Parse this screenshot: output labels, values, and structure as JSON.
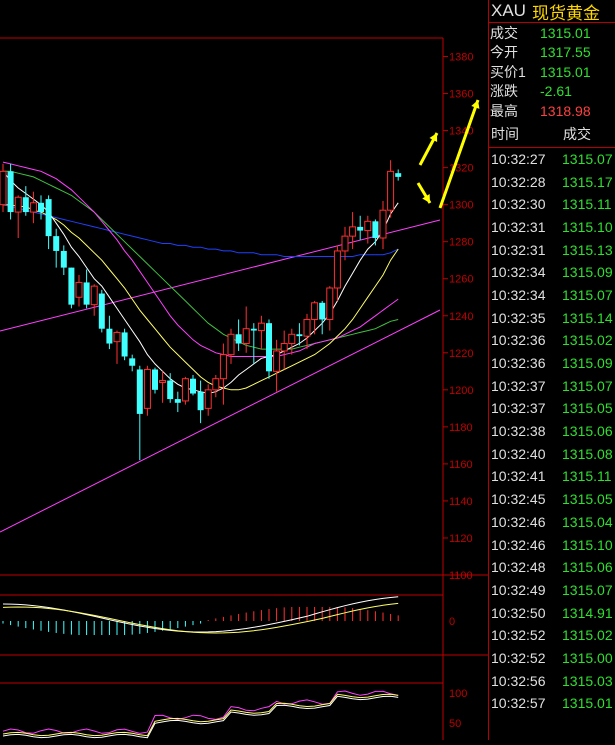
{
  "quote": {
    "code": "XAU",
    "name": "现货黄金",
    "rows": [
      {
        "label": "成交",
        "value": "1315.01",
        "color": "#2fe02f"
      },
      {
        "label": "今开",
        "value": "1317.55",
        "color": "#2fe02f"
      },
      {
        "label": "买价1",
        "value": "1315.01",
        "color": "#2fe02f"
      },
      {
        "label": "涨跌",
        "value": "-2.61",
        "color": "#2fe02f"
      },
      {
        "label": "最高",
        "value": "1318.98",
        "color": "#ff4040"
      }
    ]
  },
  "ticks": {
    "header_time": "时间",
    "header_price": "成交",
    "rows": [
      {
        "time": "10:32:27",
        "price": "1315.07"
      },
      {
        "time": "10:32:28",
        "price": "1315.17"
      },
      {
        "time": "10:32:30",
        "price": "1315.11"
      },
      {
        "time": "10:32:31",
        "price": "1315.10"
      },
      {
        "time": "10:32:31",
        "price": "1315.13"
      },
      {
        "time": "10:32:34",
        "price": "1315.09"
      },
      {
        "time": "10:32:34",
        "price": "1315.07"
      },
      {
        "time": "10:32:35",
        "price": "1315.14"
      },
      {
        "time": "10:32:36",
        "price": "1315.02"
      },
      {
        "time": "10:32:36",
        "price": "1315.09"
      },
      {
        "time": "10:32:37",
        "price": "1315.07"
      },
      {
        "time": "10:32:37",
        "price": "1315.05"
      },
      {
        "time": "10:32:38",
        "price": "1315.06"
      },
      {
        "time": "10:32:40",
        "price": "1315.08"
      },
      {
        "time": "10:32:41",
        "price": "1315.11"
      },
      {
        "time": "10:32:45",
        "price": "1315.05"
      },
      {
        "time": "10:32:46",
        "price": "1315.04"
      },
      {
        "time": "10:32:46",
        "price": "1315.10"
      },
      {
        "time": "10:32:48",
        "price": "1315.06"
      },
      {
        "time": "10:32:49",
        "price": "1315.07"
      },
      {
        "time": "10:32:50",
        "price": "1314.91"
      },
      {
        "time": "10:32:52",
        "price": "1315.02"
      },
      {
        "time": "10:32:52",
        "price": "1315.00"
      },
      {
        "time": "10:32:56",
        "price": "1315.03"
      },
      {
        "time": "10:32:57",
        "price": "1315.01"
      }
    ]
  },
  "chart_data": {
    "type": "candlestick",
    "price_axis": {
      "ticks": [
        1100,
        1120,
        1140,
        1160,
        1180,
        1200,
        1220,
        1240,
        1260,
        1280,
        1300,
        1320,
        1340,
        1360,
        1380
      ],
      "range": [
        1100,
        1390
      ]
    },
    "macd_axis": {
      "ticks": [
        "0"
      ]
    },
    "osc_axis": {
      "ticks": [
        "100",
        "50"
      ]
    },
    "colors": {
      "up": "#ff3030",
      "down": "#40ffff",
      "axis": "#c00000",
      "ma_white": "#ffffff",
      "ma_yellow": "#ffff66",
      "ma_purple": "#ff40ff",
      "ma_green": "#40c040",
      "ma_blue": "#2040ff",
      "trendline": "#ff40ff",
      "annotation_arrows": "#ffff00"
    },
    "candles": [
      {
        "o": 1300,
        "h": 1322,
        "l": 1296,
        "c": 1318
      },
      {
        "o": 1318,
        "h": 1322,
        "l": 1292,
        "c": 1296
      },
      {
        "o": 1296,
        "h": 1305,
        "l": 1282,
        "c": 1304
      },
      {
        "o": 1304,
        "h": 1310,
        "l": 1294,
        "c": 1296
      },
      {
        "o": 1296,
        "h": 1307,
        "l": 1290,
        "c": 1301
      },
      {
        "o": 1301,
        "h": 1305,
        "l": 1292,
        "c": 1296
      },
      {
        "o": 1303,
        "h": 1305,
        "l": 1276,
        "c": 1283
      },
      {
        "o": 1283,
        "h": 1287,
        "l": 1266,
        "c": 1275
      },
      {
        "o": 1275,
        "h": 1278,
        "l": 1262,
        "c": 1266
      },
      {
        "o": 1266,
        "h": 1266,
        "l": 1244,
        "c": 1246
      },
      {
        "o": 1250,
        "h": 1262,
        "l": 1245,
        "c": 1258
      },
      {
        "o": 1258,
        "h": 1265,
        "l": 1244,
        "c": 1246
      },
      {
        "o": 1246,
        "h": 1257,
        "l": 1240,
        "c": 1256
      },
      {
        "o": 1252,
        "h": 1254,
        "l": 1231,
        "c": 1233
      },
      {
        "o": 1233,
        "h": 1240,
        "l": 1222,
        "c": 1225
      },
      {
        "o": 1226,
        "h": 1232,
        "l": 1214,
        "c": 1231
      },
      {
        "o": 1231,
        "h": 1233,
        "l": 1216,
        "c": 1218
      },
      {
        "o": 1217,
        "h": 1219,
        "l": 1210,
        "c": 1213
      },
      {
        "o": 1211,
        "h": 1213,
        "l": 1162,
        "c": 1187
      },
      {
        "o": 1190,
        "h": 1213,
        "l": 1186,
        "c": 1211
      },
      {
        "o": 1211,
        "h": 1212,
        "l": 1198,
        "c": 1200
      },
      {
        "o": 1204,
        "h": 1210,
        "l": 1193,
        "c": 1205
      },
      {
        "o": 1205,
        "h": 1209,
        "l": 1193,
        "c": 1195
      },
      {
        "o": 1195,
        "h": 1199,
        "l": 1188,
        "c": 1193
      },
      {
        "o": 1194,
        "h": 1207,
        "l": 1192,
        "c": 1206
      },
      {
        "o": 1206,
        "h": 1208,
        "l": 1197,
        "c": 1198
      },
      {
        "o": 1199,
        "h": 1205,
        "l": 1182,
        "c": 1189
      },
      {
        "o": 1190,
        "h": 1203,
        "l": 1186,
        "c": 1200
      },
      {
        "o": 1200,
        "h": 1208,
        "l": 1196,
        "c": 1206
      },
      {
        "o": 1206,
        "h": 1225,
        "l": 1192,
        "c": 1219
      },
      {
        "o": 1219,
        "h": 1233,
        "l": 1214,
        "c": 1230
      },
      {
        "o": 1230,
        "h": 1238,
        "l": 1221,
        "c": 1225
      },
      {
        "o": 1225,
        "h": 1245,
        "l": 1220,
        "c": 1233
      },
      {
        "o": 1233,
        "h": 1236,
        "l": 1214,
        "c": 1232
      },
      {
        "o": 1232,
        "h": 1240,
        "l": 1222,
        "c": 1236
      },
      {
        "o": 1236,
        "h": 1238,
        "l": 1206,
        "c": 1210
      },
      {
        "o": 1210,
        "h": 1227,
        "l": 1199,
        "c": 1221
      },
      {
        "o": 1221,
        "h": 1232,
        "l": 1211,
        "c": 1225
      },
      {
        "o": 1225,
        "h": 1233,
        "l": 1219,
        "c": 1230
      },
      {
        "o": 1230,
        "h": 1236,
        "l": 1224,
        "c": 1229
      },
      {
        "o": 1229,
        "h": 1241,
        "l": 1222,
        "c": 1238
      },
      {
        "o": 1238,
        "h": 1248,
        "l": 1230,
        "c": 1247
      },
      {
        "o": 1247,
        "h": 1248,
        "l": 1230,
        "c": 1238
      },
      {
        "o": 1238,
        "h": 1256,
        "l": 1232,
        "c": 1255
      },
      {
        "o": 1255,
        "h": 1278,
        "l": 1248,
        "c": 1275
      },
      {
        "o": 1275,
        "h": 1288,
        "l": 1270,
        "c": 1283
      },
      {
        "o": 1283,
        "h": 1296,
        "l": 1276,
        "c": 1288
      },
      {
        "o": 1288,
        "h": 1294,
        "l": 1281,
        "c": 1286
      },
      {
        "o": 1286,
        "h": 1294,
        "l": 1279,
        "c": 1291
      },
      {
        "o": 1291,
        "h": 1292,
        "l": 1278,
        "c": 1282
      },
      {
        "o": 1282,
        "h": 1302,
        "l": 1276,
        "c": 1297
      },
      {
        "o": 1297,
        "h": 1324,
        "l": 1293,
        "c": 1318
      },
      {
        "o": 1317,
        "h": 1319,
        "l": 1313,
        "c": 1315
      }
    ],
    "ma_white": [
      1318,
      1313,
      1309,
      1306,
      1303,
      1300,
      1296,
      1290,
      1284,
      1277,
      1272,
      1266,
      1260,
      1256,
      1250,
      1244,
      1238,
      1232,
      1226,
      1219,
      1214,
      1210,
      1206,
      1203,
      1201,
      1200,
      1199,
      1198,
      1199,
      1201,
      1204,
      1208,
      1211,
      1214,
      1217,
      1218,
      1219,
      1221,
      1223,
      1225,
      1228,
      1232,
      1236,
      1241,
      1248,
      1256,
      1263,
      1270,
      1276,
      1280,
      1286,
      1295,
      1301
    ],
    "ma_yellow": [
      1300,
      1300,
      1299,
      1299,
      1297,
      1296,
      1294,
      1292,
      1289,
      1285,
      1282,
      1278,
      1274,
      1270,
      1265,
      1260,
      1255,
      1249,
      1243,
      1238,
      1233,
      1228,
      1223,
      1219,
      1215,
      1211,
      1207,
      1204,
      1202,
      1201,
      1200,
      1200,
      1201,
      1203,
      1205,
      1207,
      1209,
      1211,
      1213,
      1215,
      1217,
      1219,
      1222,
      1225,
      1229,
      1233,
      1238,
      1244,
      1250,
      1256,
      1262,
      1270,
      1276
    ],
    "ma_purple": [
      1323,
      1322,
      1321,
      1320,
      1319,
      1318,
      1316,
      1314,
      1311,
      1308,
      1304,
      1300,
      1296,
      1291,
      1286,
      1281,
      1275,
      1270,
      1264,
      1258,
      1252,
      1246,
      1240,
      1235,
      1231,
      1227,
      1224,
      1222,
      1220,
      1219,
      1218,
      1218,
      1218,
      1218,
      1218,
      1218,
      1218,
      1219,
      1220,
      1221,
      1223,
      1225,
      1226,
      1227,
      1228,
      1230,
      1232,
      1234,
      1237,
      1240,
      1243,
      1246,
      1249
    ],
    "ma_green": [
      1318,
      1318,
      1317,
      1316,
      1315,
      1313,
      1311,
      1309,
      1307,
      1305,
      1302,
      1299,
      1296,
      1292,
      1288,
      1284,
      1280,
      1276,
      1272,
      1268,
      1264,
      1260,
      1256,
      1252,
      1248,
      1244,
      1240,
      1236,
      1233,
      1230,
      1228,
      1226,
      1224,
      1223,
      1222,
      1222,
      1222,
      1222,
      1222,
      1223,
      1224,
      1225,
      1226,
      1227,
      1228,
      1229,
      1230,
      1231,
      1232,
      1233,
      1235,
      1237,
      1238
    ],
    "ma_blue": [
      1300,
      1299,
      1298,
      1297,
      1296,
      1295,
      1294,
      1293,
      1292,
      1291,
      1290,
      1289,
      1288,
      1287,
      1286,
      1285,
      1284,
      1283,
      1282,
      1281,
      1280,
      1279,
      1279,
      1278,
      1278,
      1277,
      1277,
      1276,
      1276,
      1275,
      1275,
      1274,
      1274,
      1274,
      1273,
      1273,
      1273,
      1272,
      1272,
      1272,
      1272,
      1272,
      1272,
      1272,
      1272,
      1272,
      1272,
      1273,
      1273,
      1273,
      1273,
      1274,
      1276
    ]
  }
}
